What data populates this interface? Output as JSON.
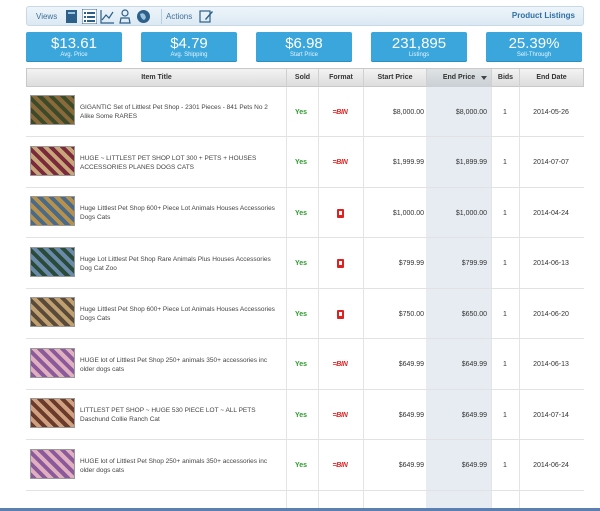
{
  "toolbar": {
    "views_label": "Views",
    "actions_label": "Actions",
    "product_listings_label": "Product Listings",
    "view_icons": [
      "book-icon",
      "list-icon",
      "line-chart-icon",
      "person-report-icon",
      "globe-icon"
    ],
    "action_icon": "edit-icon"
  },
  "stats": [
    {
      "value": "$13.61",
      "label": "Avg. Price"
    },
    {
      "value": "$4.79",
      "label": "Avg. Shipping"
    },
    {
      "value": "$6.98",
      "label": "Start Price"
    },
    {
      "value": "231,895",
      "label": "Listings"
    },
    {
      "value": "25.39%",
      "label": "Sell-Through"
    }
  ],
  "table": {
    "columns": [
      "Item Title",
      "Sold",
      "Format",
      "Start Price",
      "End Price",
      "Bids",
      "End Date"
    ],
    "sorted_column": "End Price",
    "rows": [
      {
        "title": "GIGANTIC Set of Littlest Pet Shop - 2301 Pieces - 841 Pets No 2 Alike Some RARES",
        "sold": "Yes",
        "format": "bin",
        "format_label": "=BIN",
        "start": "$8,000.00",
        "end": "$8,000.00",
        "bids": "1",
        "date": "2014-05-26"
      },
      {
        "title": "HUGE ~ LITTLEST PET SHOP LOT 300 + PETS + HOUSES ACCESSORIES PLANES DOGS CATS",
        "sold": "Yes",
        "format": "bin",
        "format_label": "=BIN",
        "start": "$1,999.99",
        "end": "$1,899.99",
        "bids": "1",
        "date": "2014-07-07"
      },
      {
        "title": "Huge Littlest Pet Shop 600+ Piece Lot Animals Houses Accessories Dogs Cats",
        "sold": "Yes",
        "format": "auction",
        "format_label": "",
        "start": "$1,000.00",
        "end": "$1,000.00",
        "bids": "1",
        "date": "2014-04-24"
      },
      {
        "title": "Huge Lot Littlest Pet Shop Rare Animals Plus Houses Accessories Dog Cat Zoo",
        "sold": "Yes",
        "format": "auction",
        "format_label": "",
        "start": "$799.99",
        "end": "$799.99",
        "bids": "1",
        "date": "2014-06-13"
      },
      {
        "title": "Huge Littlest Pet Shop 600+ Piece Lot Animals Houses Accessories Dogs Cats",
        "sold": "Yes",
        "format": "auction",
        "format_label": "",
        "start": "$750.00",
        "end": "$650.00",
        "bids": "1",
        "date": "2014-06-20"
      },
      {
        "title": "HUGE lot of Littlest Pet Shop 250+ animals 350+ accessories inc older dogs cats",
        "sold": "Yes",
        "format": "bin",
        "format_label": "=BIN",
        "start": "$649.99",
        "end": "$649.99",
        "bids": "1",
        "date": "2014-06-13"
      },
      {
        "title": "LITTLEST PET SHOP ~ HUGE 530 PIECE LOT ~ ALL PETS Daschund Collie Ranch Cat",
        "sold": "Yes",
        "format": "bin",
        "format_label": "=BIN",
        "start": "$649.99",
        "end": "$649.99",
        "bids": "1",
        "date": "2014-07-14"
      },
      {
        "title": "HUGE lot of Littlest Pet Shop 250+ animals 350+ accessories inc older dogs cats",
        "sold": "Yes",
        "format": "bin",
        "format_label": "=BIN",
        "start": "$649.99",
        "end": "$649.99",
        "bids": "1",
        "date": "2014-06-24"
      }
    ]
  },
  "colors": {
    "stat_blue": "#3aa6db",
    "sold_green": "#2e9a2e",
    "format_red": "#dd2222",
    "sorted_column_bg": "#e6ecf1"
  }
}
